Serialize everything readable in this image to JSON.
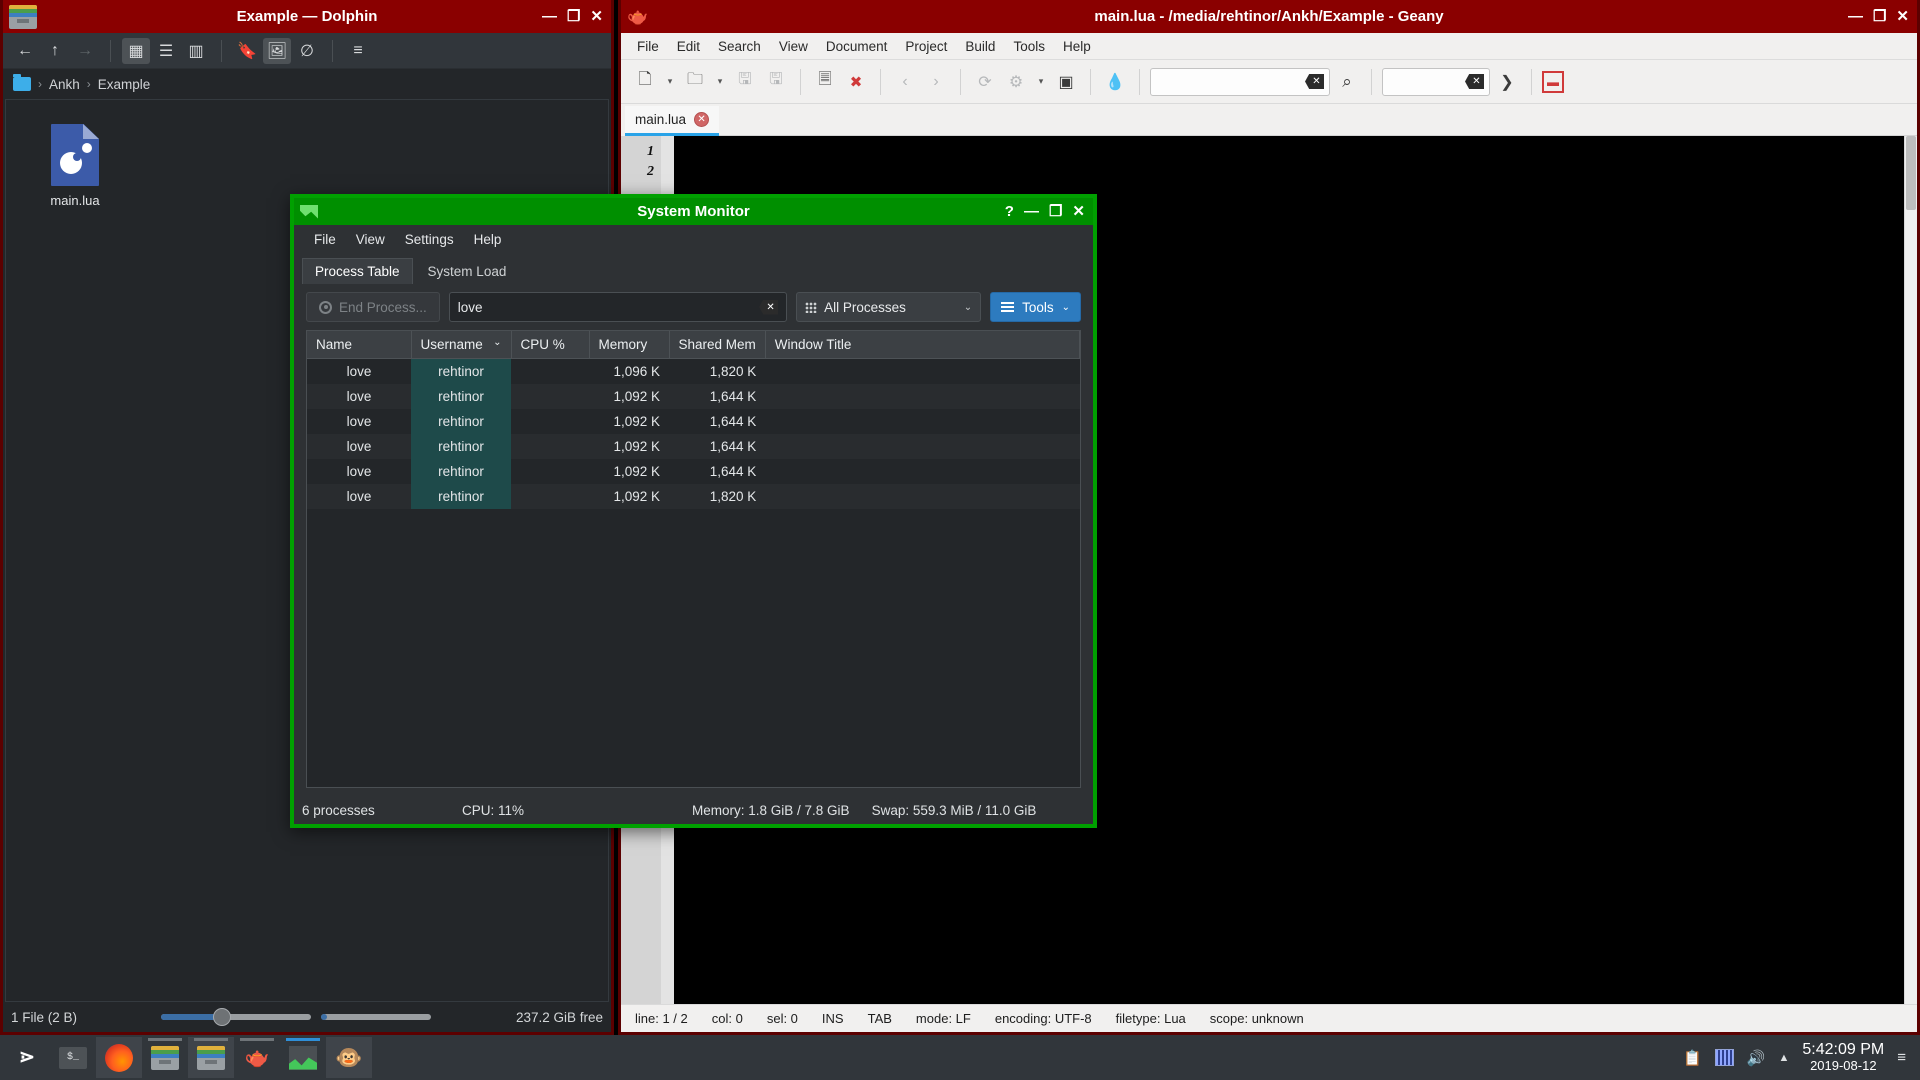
{
  "dolphin": {
    "title": "Example — Dolphin",
    "window_icon": "window-icon",
    "buttons": {
      "minimize": "—",
      "maximize": "❐",
      "close": "✕"
    },
    "toolbar": [
      {
        "name": "back-button",
        "glyph": "←",
        "state": "enabled"
      },
      {
        "name": "up-button",
        "glyph": "↑",
        "state": "enabled"
      },
      {
        "name": "forward-button",
        "glyph": "→",
        "state": "disabled"
      },
      {
        "name": "icons-view-button",
        "glyph": "▦",
        "state": "active"
      },
      {
        "name": "details-view-button",
        "glyph": "☰",
        "state": "enabled"
      },
      {
        "name": "compact-view-button",
        "glyph": "▥",
        "state": "enabled"
      },
      {
        "name": "bookmark-button",
        "glyph": "🔖",
        "state": "enabled"
      },
      {
        "name": "preview-button",
        "glyph": "🖼",
        "state": "active"
      },
      {
        "name": "hidden-files-button",
        "glyph": "∅",
        "state": "enabled"
      },
      {
        "name": "control-menu-button",
        "glyph": "≡",
        "state": "enabled"
      }
    ],
    "breadcrumb": {
      "home_icon": "folder-icon",
      "items": [
        "Ankh",
        "Example"
      ],
      "separator": "›"
    },
    "files": [
      {
        "name": "main.lua",
        "icon": "lua-file-icon"
      }
    ],
    "status": {
      "left": "1 File (2 B)",
      "right": "237.2 GiB free"
    }
  },
  "geany": {
    "title": "main.lua - /media/rehtinor/Ankh/Example - Geany",
    "window_icon": "teapot-icon",
    "buttons": {
      "minimize": "—",
      "maximize": "❐",
      "close": "✕"
    },
    "menu": [
      "File",
      "Edit",
      "Search",
      "View",
      "Document",
      "Project",
      "Build",
      "Tools",
      "Help"
    ],
    "toolbar": [
      {
        "name": "new-document-button",
        "glyph": "🗋",
        "state": "enabled"
      },
      {
        "name": "new-document-dropdown-icon",
        "glyph": "▾",
        "state": "enabled"
      },
      {
        "name": "open-document-button",
        "glyph": "🗀",
        "state": "enabled"
      },
      {
        "name": "open-document-dropdown-icon",
        "glyph": "▾",
        "state": "enabled"
      },
      {
        "name": "save-button",
        "glyph": "🖫",
        "state": "disabled"
      },
      {
        "name": "save-all-button",
        "glyph": "🖫",
        "state": "disabled"
      },
      {
        "name": "close-document-button",
        "glyph": "🗏",
        "state": "enabled"
      },
      {
        "name": "close-all-button",
        "glyph": "✖",
        "state": "enabled"
      },
      {
        "name": "back-button",
        "glyph": "‹",
        "state": "disabled"
      },
      {
        "name": "forward-button",
        "glyph": "›",
        "state": "disabled"
      },
      {
        "name": "compile-button",
        "glyph": "⟳",
        "state": "disabled"
      },
      {
        "name": "build-button",
        "glyph": "⚙",
        "state": "disabled"
      },
      {
        "name": "build-dropdown-icon",
        "glyph": "▾",
        "state": "disabled"
      },
      {
        "name": "run-button",
        "glyph": "▣",
        "state": "enabled"
      },
      {
        "name": "color-chooser-button",
        "glyph": "💧",
        "state": "enabled"
      }
    ],
    "search_field": {
      "value": "",
      "placeholder": ""
    },
    "goto_field": {
      "value": "",
      "placeholder": ""
    },
    "search_button_icon": "magnifier-icon",
    "goto_button_icon": "jump-to-icon",
    "quit_button_icon": "quit-icon",
    "tabs": [
      {
        "label": "main.lua",
        "close": "✕",
        "active": true
      }
    ],
    "editor": {
      "line_numbers": [
        "1",
        "2"
      ],
      "content": ""
    },
    "status": [
      "line: 1 / 2",
      "col: 0",
      "sel: 0",
      "INS",
      "TAB",
      "mode: LF",
      "encoding: UTF-8",
      "filetype: Lua",
      "scope: unknown"
    ]
  },
  "sysmon": {
    "title": "System Monitor",
    "window_icon": "system-monitor-icon",
    "buttons": {
      "help": "?",
      "minimize": "—",
      "maximize": "❐",
      "close": "✕"
    },
    "menu": [
      "File",
      "View",
      "Settings",
      "Help"
    ],
    "tabs": [
      {
        "label": "Process Table",
        "active": true
      },
      {
        "label": "System Load",
        "active": false
      }
    ],
    "toolbar": {
      "end_process_label": "End Process...",
      "end_process_enabled": false,
      "search_value": "love",
      "search_clear_icon": "clear-icon",
      "filter_label": "All Processes",
      "filter_chevron": "⌄",
      "tools_label": "Tools",
      "tools_chevron": "⌄"
    },
    "table": {
      "columns": [
        "Name",
        "Username",
        "CPU %",
        "Memory",
        "Shared Mem",
        "Window Title"
      ],
      "sort_column": "Username",
      "sort_indicator": "⌄",
      "rows": [
        {
          "name": "love",
          "username": "rehtinor",
          "cpu": "",
          "memory": "1,096 K",
          "shared": "1,820 K",
          "window": ""
        },
        {
          "name": "love",
          "username": "rehtinor",
          "cpu": "",
          "memory": "1,092 K",
          "shared": "1,644 K",
          "window": ""
        },
        {
          "name": "love",
          "username": "rehtinor",
          "cpu": "",
          "memory": "1,092 K",
          "shared": "1,644 K",
          "window": ""
        },
        {
          "name": "love",
          "username": "rehtinor",
          "cpu": "",
          "memory": "1,092 K",
          "shared": "1,644 K",
          "window": ""
        },
        {
          "name": "love",
          "username": "rehtinor",
          "cpu": "",
          "memory": "1,092 K",
          "shared": "1,644 K",
          "window": ""
        },
        {
          "name": "love",
          "username": "rehtinor",
          "cpu": "",
          "memory": "1,092 K",
          "shared": "1,820 K",
          "window": ""
        }
      ]
    },
    "status": {
      "processes": "6 processes",
      "cpu": "CPU: 11%",
      "memory": "Memory: 1.8 GiB / 7.8 GiB",
      "swap": "Swap: 559.3 MiB / 11.0 GiB"
    },
    "accent_color": "#00a000"
  },
  "taskbar": {
    "launcher_icon": "kde-menu-icon",
    "items": [
      {
        "name": "terminal",
        "icon": "terminal-icon",
        "active": false,
        "indicator": "none"
      },
      {
        "name": "firefox",
        "icon": "firefox-icon",
        "active": true,
        "indicator": "none"
      },
      {
        "name": "dolphin-1",
        "icon": "dolphin-icon",
        "active": false,
        "indicator": "gray"
      },
      {
        "name": "dolphin-2",
        "icon": "dolphin-icon",
        "active": true,
        "indicator": "gray"
      },
      {
        "name": "geany",
        "icon": "teapot-icon",
        "active": false,
        "indicator": "none"
      },
      {
        "name": "system-monitor",
        "icon": "system-monitor-icon",
        "active": false,
        "indicator": "blue"
      },
      {
        "name": "monkey-app",
        "icon": "monkey-icon",
        "active": true,
        "indicator": "none"
      }
    ],
    "tray": [
      {
        "name": "clipboard-icon",
        "glyph": "📋"
      },
      {
        "name": "network-monitor-icon",
        "glyph": ""
      },
      {
        "name": "volume-icon",
        "glyph": "🔊"
      },
      {
        "name": "show-hidden-icon",
        "glyph": "▲"
      }
    ],
    "clock": {
      "time": "5:42:09 PM",
      "date": "2019-08-12"
    },
    "show_desktop_icon": "≡"
  }
}
